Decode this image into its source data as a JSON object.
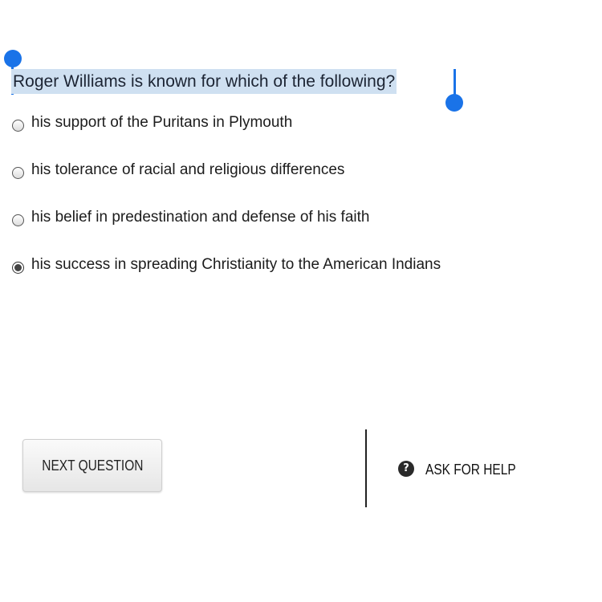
{
  "question": {
    "text": "Roger Williams is known for which of the following?"
  },
  "options": [
    {
      "label": "his support of the Puritans in Plymouth",
      "selected": false
    },
    {
      "label": "his tolerance of racial and religious differences",
      "selected": false
    },
    {
      "label": "his belief in predestination and defense of his faith",
      "selected": false
    },
    {
      "label": "his success in spreading Christianity to the American Indians",
      "selected": true
    }
  ],
  "actions": {
    "next_label": "NEXT QUESTION",
    "help_label": "ASK FOR HELP",
    "help_icon": "question-circle-icon",
    "help_glyph": "?"
  },
  "colors": {
    "selection_highlight": "#cfe0f1",
    "selection_handle": "#1a73e8"
  }
}
